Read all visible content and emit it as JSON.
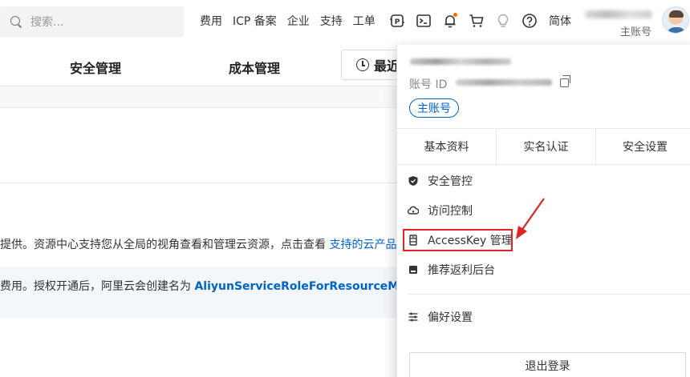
{
  "search": {
    "placeholder": "搜索..."
  },
  "nav": {
    "links": [
      "费用",
      "ICP 备案",
      "企业",
      "支持",
      "工单"
    ],
    "icons": [
      "ai-assistant-icon",
      "terminal-icon",
      "bell-icon",
      "cart-icon",
      "lightbulb-icon",
      "help-icon"
    ],
    "language": "简体"
  },
  "account": {
    "role": "主账号"
  },
  "page": {
    "tabs": {
      "security": "安全管理",
      "cost": "成本管理",
      "recent": "最近"
    },
    "line1_text": "提供。资源中心支持您从全局的视角查看和管理云资源，点击查看 ",
    "line1_link": "支持的云产品",
    "line2_text": "费用。授权开通后，阿里云会创建名为 ",
    "line2_link": "AliyunServiceRoleForResourceMetaCente"
  },
  "dropdown": {
    "id_label": "账号 ID",
    "role_badge": "主账号",
    "tabs": [
      "基本资料",
      "实名认证",
      "安全设置"
    ],
    "menu": [
      {
        "label": "安全管控",
        "icon": "shield-icon"
      },
      {
        "label": "访问控制",
        "icon": "cloud-key-icon"
      },
      {
        "label": "AccessKey 管理",
        "icon": "accesskey-icon"
      },
      {
        "label": "推荐返利后台",
        "icon": "gift-icon"
      },
      {
        "label": "偏好设置",
        "icon": "sliders-icon"
      }
    ],
    "logout": "退出登录"
  },
  "colors": {
    "link": "#0064c8",
    "highlight": "#e02424",
    "notice_bg": "#f3f6fa",
    "bell_dot": "#ff6a00"
  }
}
